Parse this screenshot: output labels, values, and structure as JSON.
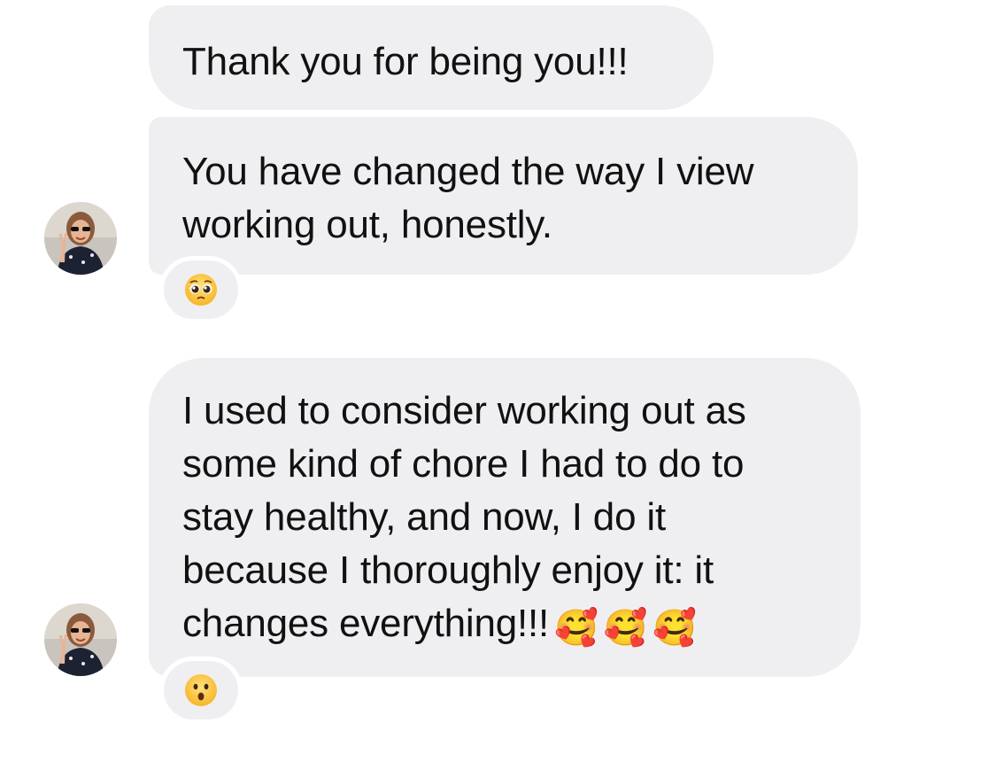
{
  "messages": [
    {
      "lines": [
        "Thank you for being you!!!"
      ]
    },
    {
      "lines": [
        "You have changed the way I view",
        "working out, honestly."
      ],
      "reaction": {
        "icon": "pleading-face-icon"
      }
    },
    {
      "lines": [
        "I used to consider working out as",
        "some kind of chore I had to do to",
        "stay healthy, and now, I do it",
        "because I thoroughly enjoy it: it",
        "changes everything!!!"
      ],
      "trailing_emojis": [
        "🥰",
        "🥰",
        "🥰"
      ],
      "reaction": {
        "icon": "surprised-face-icon"
      }
    }
  ],
  "avatar": {
    "icon": "sender-avatar"
  },
  "colors": {
    "bubble": "#efeff1",
    "text": "#111111",
    "background": "#ffffff"
  }
}
